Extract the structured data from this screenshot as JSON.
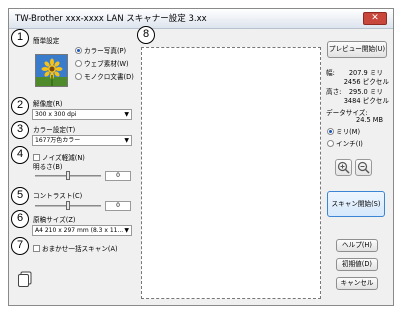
{
  "window": {
    "title": "TW-Brother xxx-xxxx LAN スキャナー設定 3.xx"
  },
  "markers": [
    "1",
    "2",
    "3",
    "4",
    "5",
    "6",
    "7",
    "8"
  ],
  "scan_settings": {
    "label": "簡単設定",
    "modes": [
      {
        "label": "カラー写真(P)",
        "selected": true
      },
      {
        "label": "ウェブ素材(W)",
        "selected": false
      },
      {
        "label": "モノクロ文書(D)",
        "selected": false
      }
    ]
  },
  "resolution": {
    "label": "解像度(R)",
    "value": "300 x 300 dpi"
  },
  "color": {
    "label": "カラー設定(T)",
    "value": "1677万色カラー"
  },
  "noise": {
    "label": "ノイズ軽減(N)",
    "checked": false
  },
  "brightness": {
    "label": "明るさ(B)",
    "value": "0"
  },
  "contrast": {
    "label": "コントラスト(C)",
    "value": "0"
  },
  "document_size": {
    "label": "原稿サイズ(Z)",
    "value": "A4 210 x 297 mm (8.3 x 11..."
  },
  "auto_crop": {
    "label": "おまかせ一括スキャン(A)",
    "checked": false
  },
  "buttons": {
    "preview": "プレビュー開始(U)",
    "scan": "スキャン開始(S)",
    "help": "ヘルプ(H)",
    "defaults": "初期値(D)",
    "cancel": "キャンセル"
  },
  "info": {
    "width_label": "幅:",
    "width_mm": "207.9 ミリ",
    "width_px": "2456 ピクセル",
    "height_label": "高さ:",
    "height_mm": "295.0 ミリ",
    "height_px": "3484 ピクセル",
    "datasize_label": "データサイズ:",
    "datasize_value": "24.5 MB"
  },
  "units": [
    {
      "label": "ミリ(M)",
      "selected": true
    },
    {
      "label": "インチ(I)",
      "selected": false
    }
  ],
  "icons": {
    "close": "close-icon",
    "zoom_in": "zoom-in-icon",
    "zoom_out": "zoom-out-icon",
    "pages": "pages-icon",
    "photo": "color-photo-icon"
  }
}
